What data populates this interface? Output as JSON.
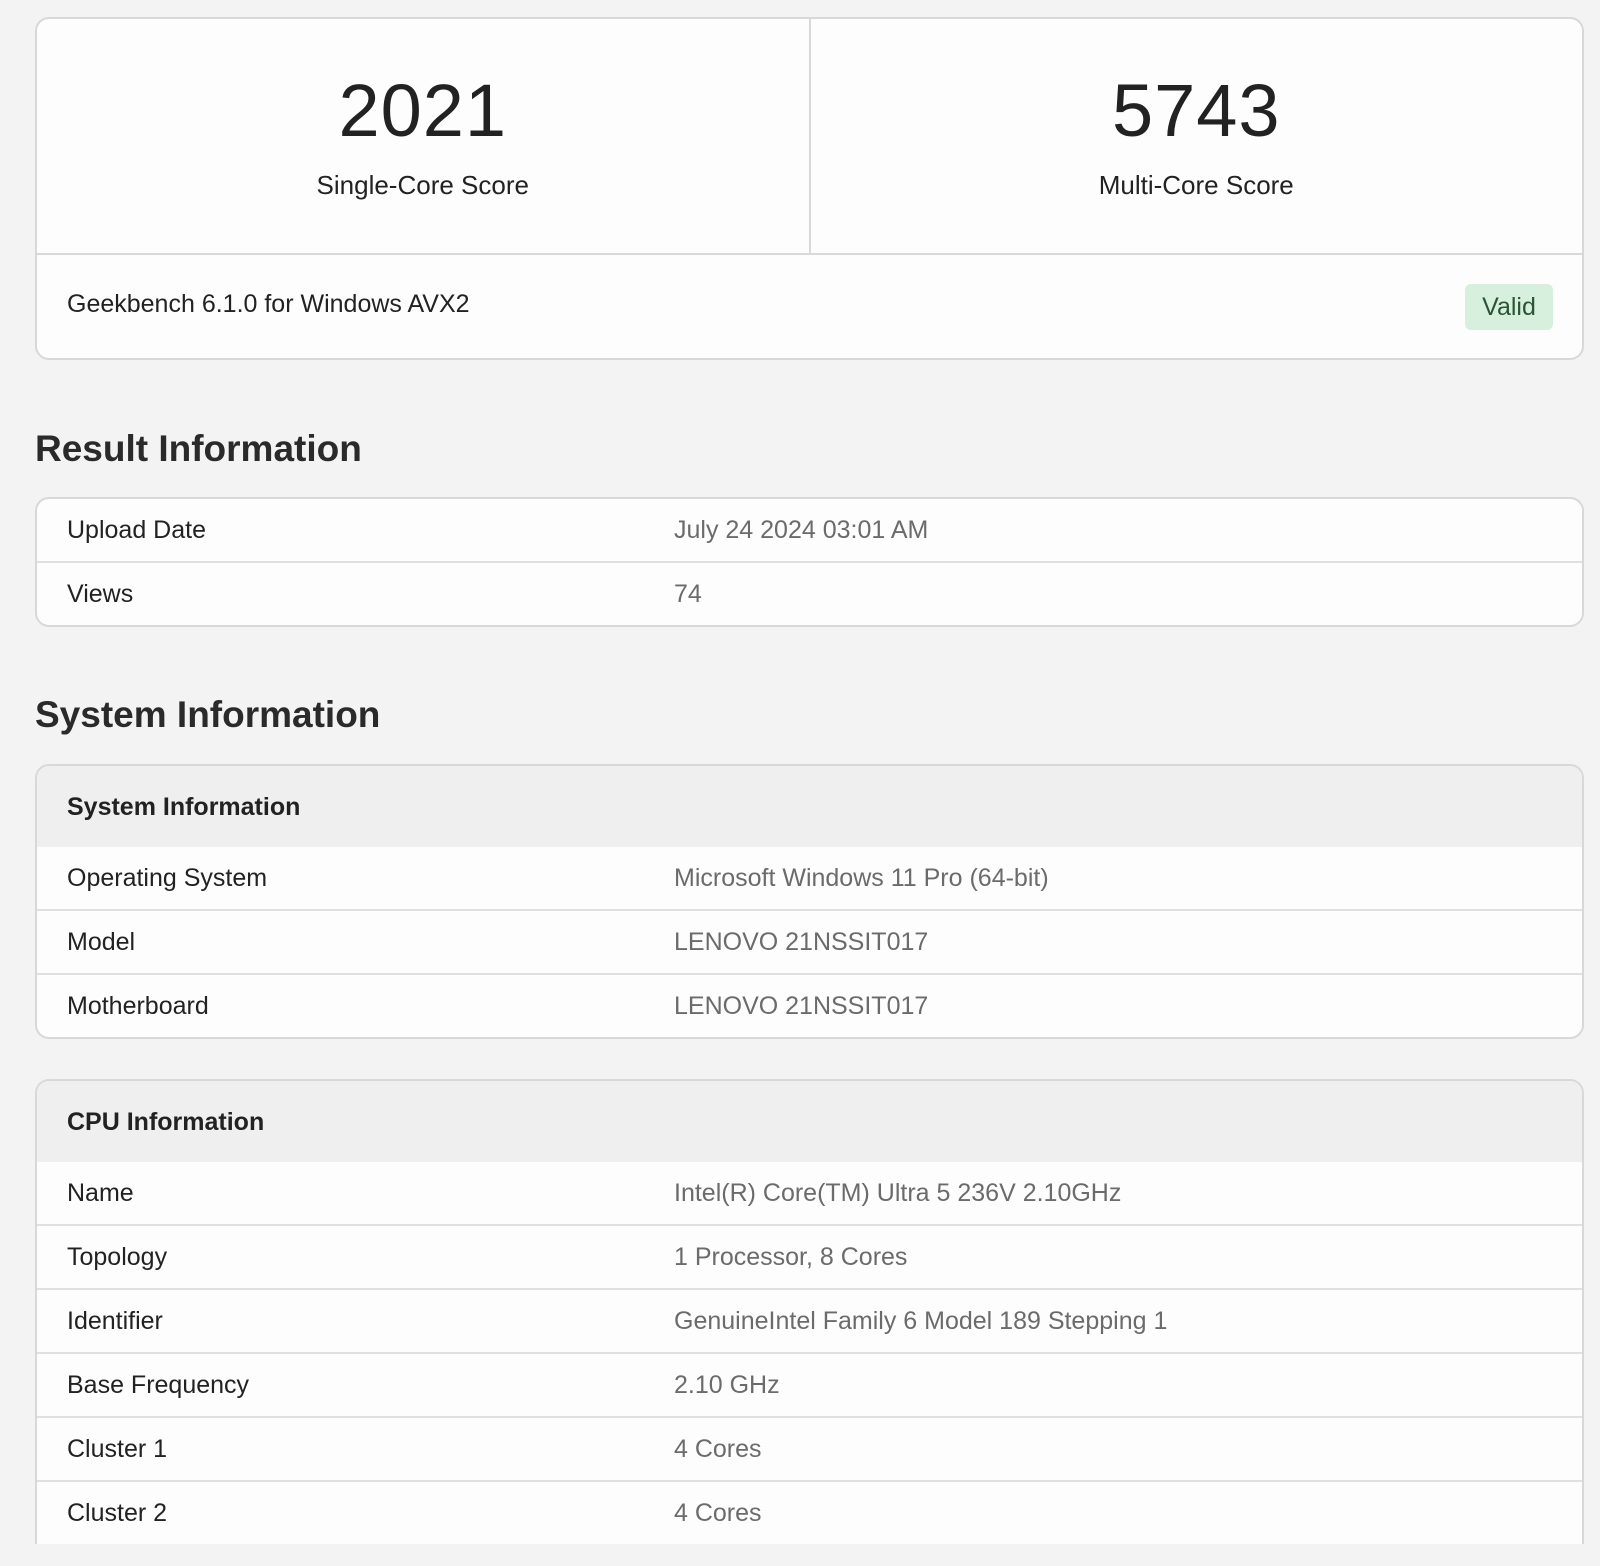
{
  "scores": {
    "single_core": {
      "value": "2021",
      "label": "Single-Core Score"
    },
    "multi_core": {
      "value": "5743",
      "label": "Multi-Core Score"
    },
    "version": "Geekbench 6.1.0 for Windows AVX2",
    "status": "Valid",
    "status_color": "#d7efdd"
  },
  "result_info": {
    "title": "Result Information",
    "rows": [
      {
        "key": "Upload Date",
        "value": "July 24 2024 03:01 AM"
      },
      {
        "key": "Views",
        "value": "74"
      }
    ]
  },
  "system_info": {
    "title": "System Information",
    "system_card": {
      "header": "System Information",
      "rows": [
        {
          "key": "Operating System",
          "value": "Microsoft Windows 11 Pro (64-bit)"
        },
        {
          "key": "Model",
          "value": "LENOVO 21NSSIT017"
        },
        {
          "key": "Motherboard",
          "value": "LENOVO 21NSSIT017"
        }
      ]
    },
    "cpu_card": {
      "header": "CPU Information",
      "rows": [
        {
          "key": "Name",
          "value": "Intel(R) Core(TM) Ultra 5 236V 2.10GHz"
        },
        {
          "key": "Topology",
          "value": "1 Processor, 8 Cores"
        },
        {
          "key": "Identifier",
          "value": "GenuineIntel Family 6 Model 189 Stepping 1"
        },
        {
          "key": "Base Frequency",
          "value": "2.10 GHz"
        },
        {
          "key": "Cluster 1",
          "value": "4 Cores"
        },
        {
          "key": "Cluster 2",
          "value": "4 Cores"
        }
      ]
    }
  }
}
